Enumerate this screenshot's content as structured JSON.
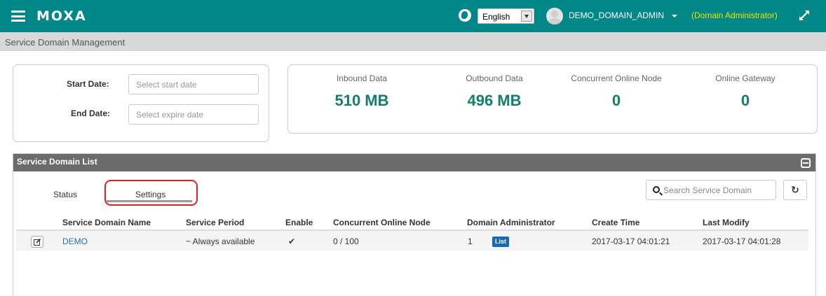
{
  "header": {
    "logo": "MOXA",
    "language": "English",
    "user": "DEMO_DOMAIN_ADMIN",
    "role": "(Domain Administrator)"
  },
  "breadcrumb": "Service Domain Management",
  "dates": {
    "start_label": "Start Date:",
    "start_placeholder": "Select start date",
    "end_label": "End Date:",
    "end_placeholder": "Select expire date"
  },
  "stats": [
    {
      "label": "Inbound Data",
      "value": "510 MB"
    },
    {
      "label": "Outbound Data",
      "value": "496 MB"
    },
    {
      "label": "Concurrent Online Node",
      "value": "0"
    },
    {
      "label": "Online Gateway",
      "value": "0"
    }
  ],
  "list": {
    "title": "Service Domain List",
    "tabs": [
      "Status",
      "Settings"
    ],
    "search_placeholder": "Search Service Domain",
    "columns": [
      "Service Domain Name",
      "Service Period",
      "Enable",
      "Concurrent Online Node",
      "Domain Administrator",
      "Create Time",
      "Last Modify"
    ],
    "rows": [
      {
        "name": "DEMO",
        "period": "~ Always available",
        "enabled": "✔",
        "nodes": "0 / 100",
        "admin_count": "1",
        "admin_badge": "List",
        "created": "2017-03-17 04:01:21",
        "modified": "2017-03-17 04:01:28"
      }
    ]
  },
  "colors": {
    "header_bg": "#008787",
    "role_text": "#f0e500",
    "stat_value": "#117f6b",
    "link": "#2f6fb5",
    "highlight": "#e02020"
  }
}
